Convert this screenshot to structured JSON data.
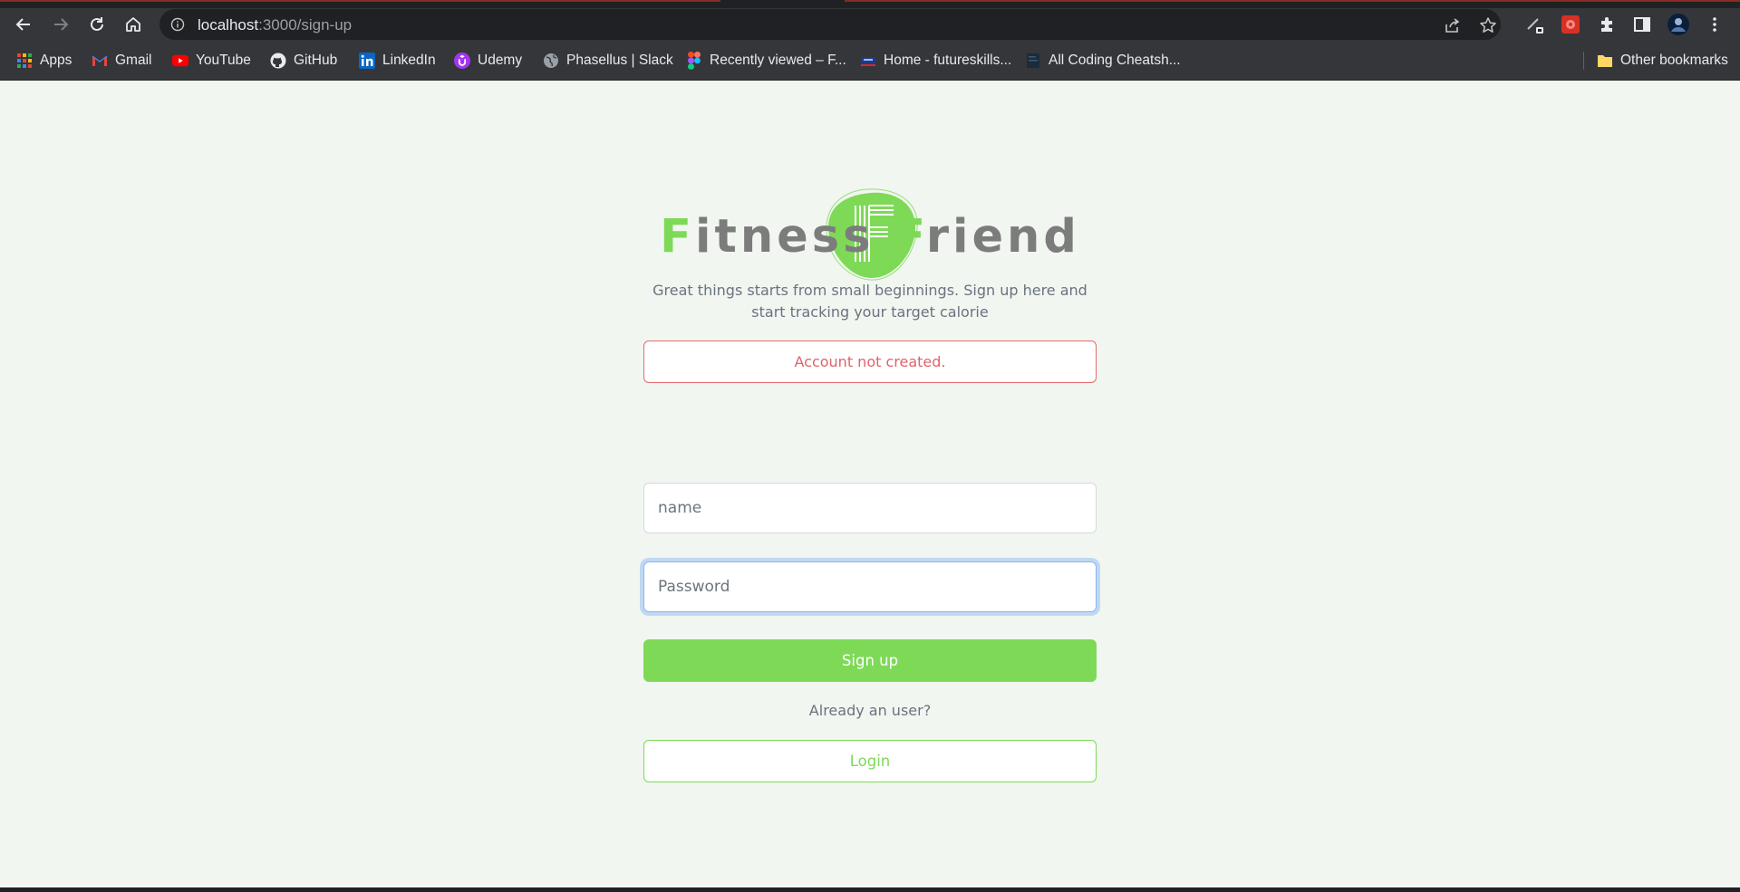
{
  "browser": {
    "url_host": "localhost",
    "url_path": ":3000/sign-up",
    "bookmarks": [
      {
        "label": "Apps",
        "icon": "apps-grid-icon"
      },
      {
        "label": "Gmail",
        "icon": "gmail-icon"
      },
      {
        "label": "YouTube",
        "icon": "youtube-icon"
      },
      {
        "label": "GitHub",
        "icon": "github-icon"
      },
      {
        "label": "LinkedIn",
        "icon": "linkedin-icon"
      },
      {
        "label": "Udemy",
        "icon": "udemy-icon"
      },
      {
        "label": "Phasellus | Slack",
        "icon": "globe-icon"
      },
      {
        "label": "Recently viewed – F...",
        "icon": "figma-icon"
      },
      {
        "label": "Home - futureskills...",
        "icon": "futureskills-icon"
      },
      {
        "label": "All Coding Cheatsh...",
        "icon": "page-icon"
      }
    ],
    "other_bookmarks": "Other bookmarks"
  },
  "page": {
    "brand_first_initial": "F",
    "brand_first_rest": "itness",
    "brand_second_initial": "F",
    "brand_second_rest": "riend",
    "tagline": "Great things starts from small beginnings. Sign up here and start tracking your target calorie",
    "alert_message": "Account not created.",
    "name_placeholder": "name",
    "password_placeholder": "Password",
    "signup_label": "Sign up",
    "already_text": "Already an user?",
    "login_label": "Login"
  },
  "colors": {
    "accent": "#7ed957",
    "alert": "#e0636b",
    "background": "#f1f6f0",
    "brand_text": "#7c7c7c"
  }
}
